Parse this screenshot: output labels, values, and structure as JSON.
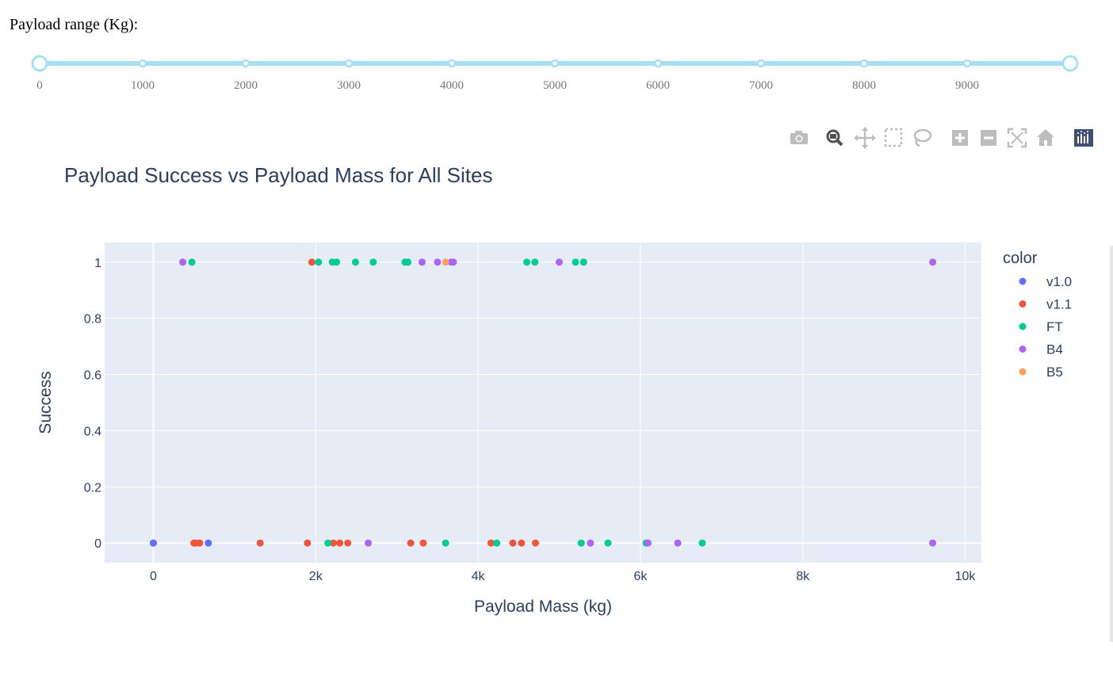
{
  "slider": {
    "label": "Payload range (Kg):",
    "ticks": [
      "0",
      "1000",
      "2000",
      "3000",
      "4000",
      "5000",
      "6000",
      "7000",
      "8000",
      "9000"
    ],
    "tick_values": [
      0,
      1000,
      2000,
      3000,
      4000,
      5000,
      6000,
      7000,
      8000,
      9000
    ],
    "min": 0,
    "max": 10000,
    "selected": [
      0,
      10000
    ],
    "color": "#a7dff2"
  },
  "modebar": [
    "camera-icon",
    "zoom-icon",
    "pan-icon",
    "box-select-icon",
    "lasso-icon",
    "zoom-in-icon",
    "zoom-out-icon",
    "autoscale-icon",
    "reset-axes-icon",
    "plotly-logo"
  ],
  "chart_data": {
    "type": "scatter",
    "title": "Payload Success vs Payload Mass for All Sites",
    "xlabel": "Payload Mass (kg)",
    "ylabel": "Success",
    "xlim": [
      -600,
      10200
    ],
    "ylim": [
      -0.07,
      1.07
    ],
    "xticks": [
      0,
      2000,
      4000,
      6000,
      8000,
      10000
    ],
    "xtick_labels": [
      "0",
      "2k",
      "4k",
      "6k",
      "8k",
      "10k"
    ],
    "yticks": [
      0,
      0.2,
      0.4,
      0.6,
      0.8,
      1
    ],
    "ytick_labels": [
      "0",
      "0.2",
      "0.4",
      "0.6",
      "0.8",
      "1"
    ],
    "legend_title": "color",
    "legend_position": "right",
    "grid": true,
    "series": [
      {
        "name": "v1.0",
        "color": "#636efa",
        "points": [
          [
            0,
            0
          ],
          [
            0,
            0
          ],
          [
            677,
            0
          ]
        ]
      },
      {
        "name": "v1.1",
        "color": "#ef553b",
        "points": [
          [
            500,
            0
          ],
          [
            525,
            0
          ],
          [
            570,
            0
          ],
          [
            1316,
            0
          ],
          [
            1898,
            0
          ],
          [
            1952,
            1
          ],
          [
            2216,
            0
          ],
          [
            2296,
            0
          ],
          [
            2395,
            0
          ],
          [
            3170,
            0
          ],
          [
            3325,
            0
          ],
          [
            4159,
            0
          ],
          [
            4428,
            0
          ],
          [
            4535,
            0
          ],
          [
            4707,
            0
          ]
        ]
      },
      {
        "name": "FT",
        "color": "#00cc96",
        "points": [
          [
            475,
            1
          ],
          [
            2034,
            1
          ],
          [
            2150,
            0
          ],
          [
            2205,
            1
          ],
          [
            2257,
            1
          ],
          [
            2490,
            1
          ],
          [
            2708,
            1
          ],
          [
            3100,
            1
          ],
          [
            3136,
            1
          ],
          [
            3600,
            0
          ],
          [
            4230,
            0
          ],
          [
            4600,
            1
          ],
          [
            4700,
            1
          ],
          [
            5200,
            1
          ],
          [
            5300,
            1
          ],
          [
            5271,
            0
          ],
          [
            5600,
            0
          ],
          [
            6070,
            0
          ],
          [
            6761,
            0
          ]
        ]
      },
      {
        "name": "B4",
        "color": "#ab63fa",
        "points": [
          [
            362,
            1
          ],
          [
            2647,
            0
          ],
          [
            3310,
            1
          ],
          [
            3500,
            1
          ],
          [
            3669,
            1
          ],
          [
            3696,
            1
          ],
          [
            5000,
            1
          ],
          [
            5384,
            0
          ],
          [
            6092,
            0
          ],
          [
            6460,
            0
          ],
          [
            9600,
            1
          ],
          [
            9600,
            0
          ]
        ]
      },
      {
        "name": "B5",
        "color": "#ffa15a",
        "points": [
          [
            3600,
            1
          ]
        ]
      }
    ]
  }
}
